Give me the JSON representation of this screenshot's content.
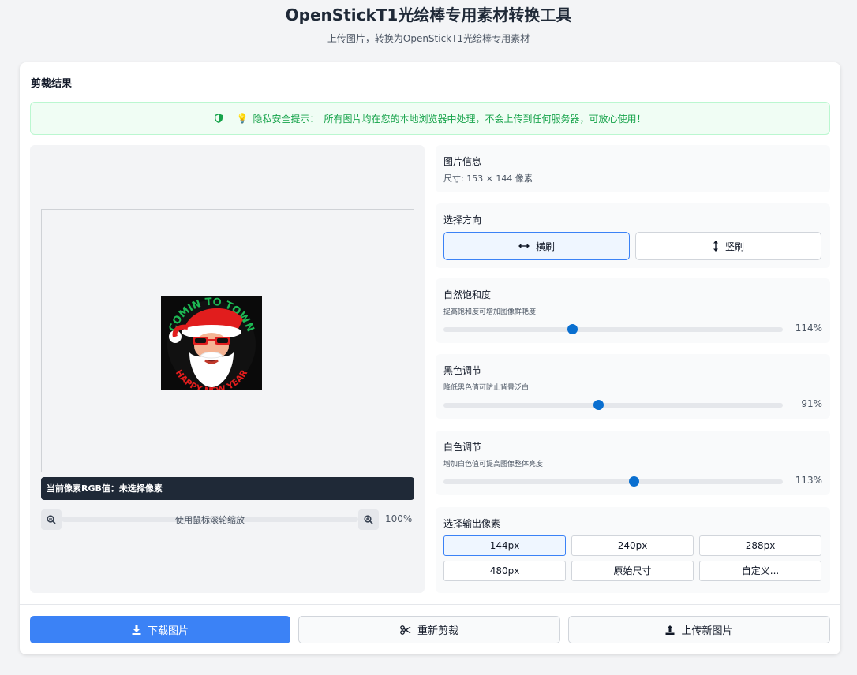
{
  "header": {
    "title": "OpenStickT1光绘棒专用素材转换工具",
    "subtitle": "上传图片，转换为OpenStickT1光绘棒专用素材"
  },
  "card": {
    "title": "剪裁结果"
  },
  "privacy": {
    "label": "隐私安全提示：",
    "text": "所有图片均在您的本地浏览器中处理，不会上传到任何服务器，可放心使用！",
    "color": "#16a34a"
  },
  "preview": {
    "image_text_top": "COMIN TO TOWN",
    "image_text_bottom": "HAPPY NEW YEAR",
    "rgb_label": "当前像素RGB值：未选择像素",
    "zoom_hint": "使用鼠标滚轮缩放",
    "zoom_value": "100%"
  },
  "info": {
    "title": "图片信息",
    "size": "尺寸: 153 × 144 像素"
  },
  "direction": {
    "title": "选择方向",
    "horizontal": "横刷",
    "vertical": "竖刷",
    "selected": "horizontal"
  },
  "saturation": {
    "title": "自然饱和度",
    "hint": "提高饱和度可增加图像鲜艳度",
    "value_label": "114%",
    "fraction": 0.38
  },
  "black": {
    "title": "黑色调节",
    "hint": "降低黑色值可防止背景泛白",
    "value_label": "91%",
    "fraction": 0.455
  },
  "white": {
    "title": "白色调节",
    "hint": "增加白色值可提高图像整体亮度",
    "value_label": "113%",
    "fraction": 0.56
  },
  "output": {
    "title": "选择输出像素",
    "options": [
      "144px",
      "240px",
      "288px",
      "480px",
      "原始尺寸",
      "自定义..."
    ],
    "selected": "144px"
  },
  "actions": {
    "download": "下载图片",
    "recrop": "重新剪裁",
    "upload": "上传新图片"
  },
  "colors": {
    "accent": "#3b82f6",
    "slider_thumb": "#0a6fd0",
    "dark_bar": "#1f2937"
  }
}
